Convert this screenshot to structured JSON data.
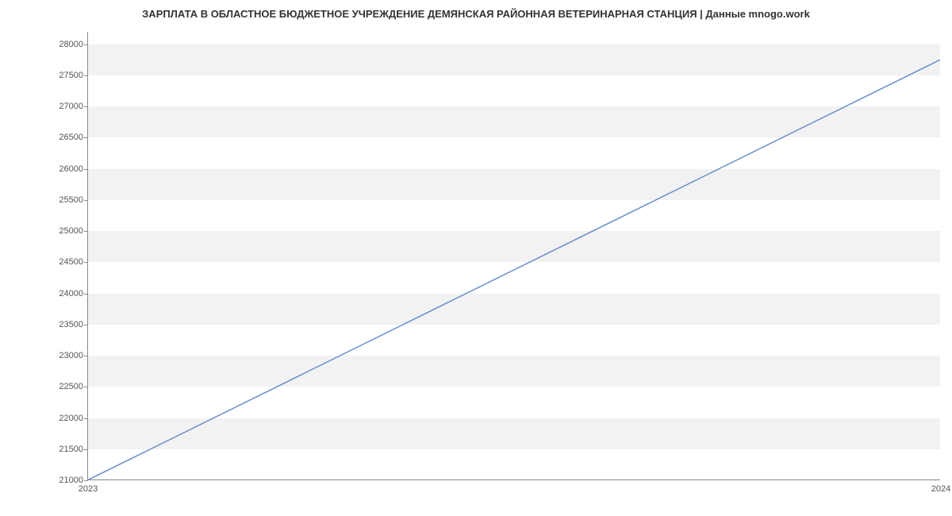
{
  "chart_data": {
    "type": "line",
    "title": "ЗАРПЛАТА В ОБЛАСТНОЕ БЮДЖЕТНОЕ УЧРЕЖДЕНИЕ ДЕМЯНСКАЯ РАЙОННАЯ ВЕТЕРИНАРНАЯ СТАНЦИЯ | Данные mnogo.work",
    "xlabel": "",
    "ylabel": "",
    "x": [
      2023,
      2024
    ],
    "values": [
      21000,
      27750
    ],
    "x_tick_labels": [
      "2023",
      "2024"
    ],
    "y_ticks": [
      21000,
      21500,
      22000,
      22500,
      23000,
      23500,
      24000,
      24500,
      25000,
      25500,
      26000,
      26500,
      27000,
      27500,
      28000
    ],
    "ylim": [
      21000,
      28200
    ],
    "xlim": [
      2023,
      2024
    ],
    "line_color": "#6a8ecb"
  }
}
